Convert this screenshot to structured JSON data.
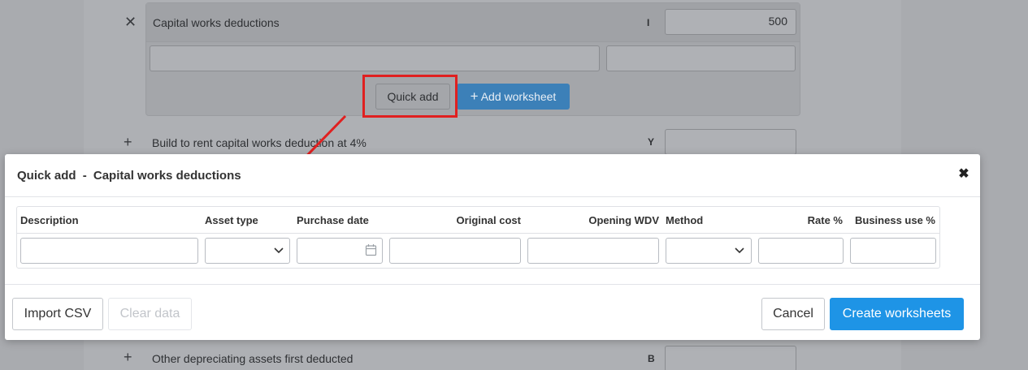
{
  "background": {
    "capital_works": {
      "label": "Capital works deductions",
      "letter": "I",
      "value": "500",
      "quick_add_label": "Quick add",
      "add_worksheet_label": "Add worksheet"
    },
    "build_to_rent": {
      "label": "Build to rent capital works deduction at 4%",
      "letter": "Y"
    },
    "other_depreciating": {
      "label": "Other depreciating assets first deducted",
      "letter": "B"
    },
    "icons": {
      "remove": "close-icon",
      "expand": "plus-icon",
      "add": "plus-icon"
    }
  },
  "modal": {
    "title": "Quick add",
    "title_separator": "-",
    "subtitle": "Capital works deductions",
    "close_icon": "close-icon",
    "columns": {
      "description": "Description",
      "asset_type": "Asset type",
      "purchase_date": "Purchase date",
      "original_cost": "Original cost",
      "opening_wdv": "Opening WDV",
      "method": "Method",
      "rate": "Rate %",
      "business_use": "Business use %"
    },
    "row": {
      "description": "",
      "asset_type": "",
      "purchase_date": "",
      "original_cost": "",
      "opening_wdv": "",
      "method": "",
      "rate": "",
      "business_use": ""
    },
    "footer": {
      "import_csv": "Import CSV",
      "clear_data": "Clear data",
      "cancel": "Cancel",
      "create_worksheets": "Create worksheets"
    }
  },
  "colors": {
    "primary": "#1e94e6",
    "highlight": "#e02020",
    "overlay": "#a9abaf"
  }
}
